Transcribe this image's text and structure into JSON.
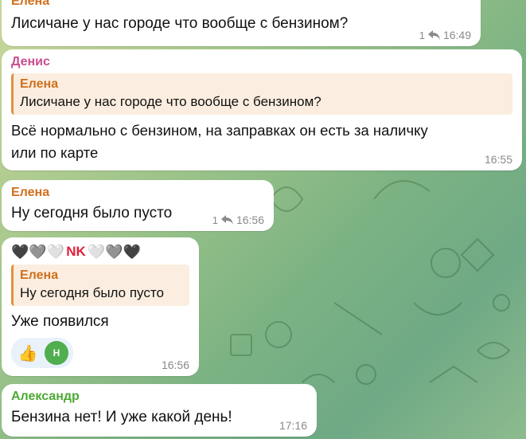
{
  "colors": {
    "elena": "#d0701c",
    "denis": "#c94d8f",
    "aleksandr": "#4caa34"
  },
  "messages": [
    {
      "sender": "Елена",
      "text": "Лисичане у нас городе что вообще с бензином?",
      "replies": "1",
      "time": "16:49"
    },
    {
      "sender": "Денис",
      "quote_sender": "Елена",
      "quote_text": "Лисичане у нас городе что вообще с бензином?",
      "text_line1": "Всё нормально с бензином, на заправках он есть за наличку",
      "text_line2": "или по карте",
      "time": "16:55"
    },
    {
      "sender": "Елена",
      "text": "Ну сегодня было пусто",
      "replies": "1",
      "time": "16:56"
    },
    {
      "sender_hearts_left": "🖤🩶🤍",
      "sender_name": "NK",
      "sender_hearts_right": "🤍🩶🖤",
      "quote_sender": "Елена",
      "quote_text": "Ну сегодня было пусто",
      "text": "Уже появился",
      "reaction_emoji": "👍",
      "reaction_avatar": "Н",
      "time": "16:56"
    },
    {
      "sender": "Александр",
      "text": "Бензина нет! И уже какой день!",
      "time": "17:16"
    }
  ]
}
